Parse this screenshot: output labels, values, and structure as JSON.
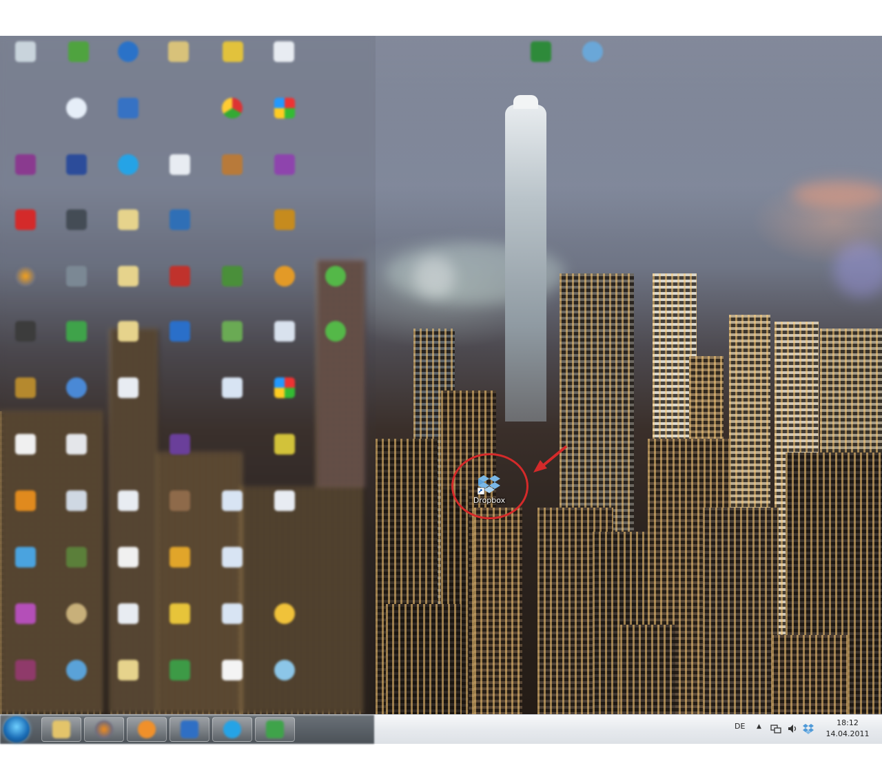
{
  "highlighted_icon": {
    "label": "Dropbox",
    "icon": "dropbox-icon",
    "circle_color": "#d42a2a"
  },
  "taskbar": {
    "start": "windows-start-orb",
    "pinned": [
      "explorer-icon",
      "firefox-icon",
      "media-player-icon",
      "word-icon",
      "skype-icon",
      "app-icon"
    ],
    "language": "DE",
    "tray_icons": [
      "network-icon",
      "volume-icon",
      "dropbox-tray-icon"
    ],
    "clock": {
      "time": "18:12",
      "date": "14.04.2011"
    }
  }
}
